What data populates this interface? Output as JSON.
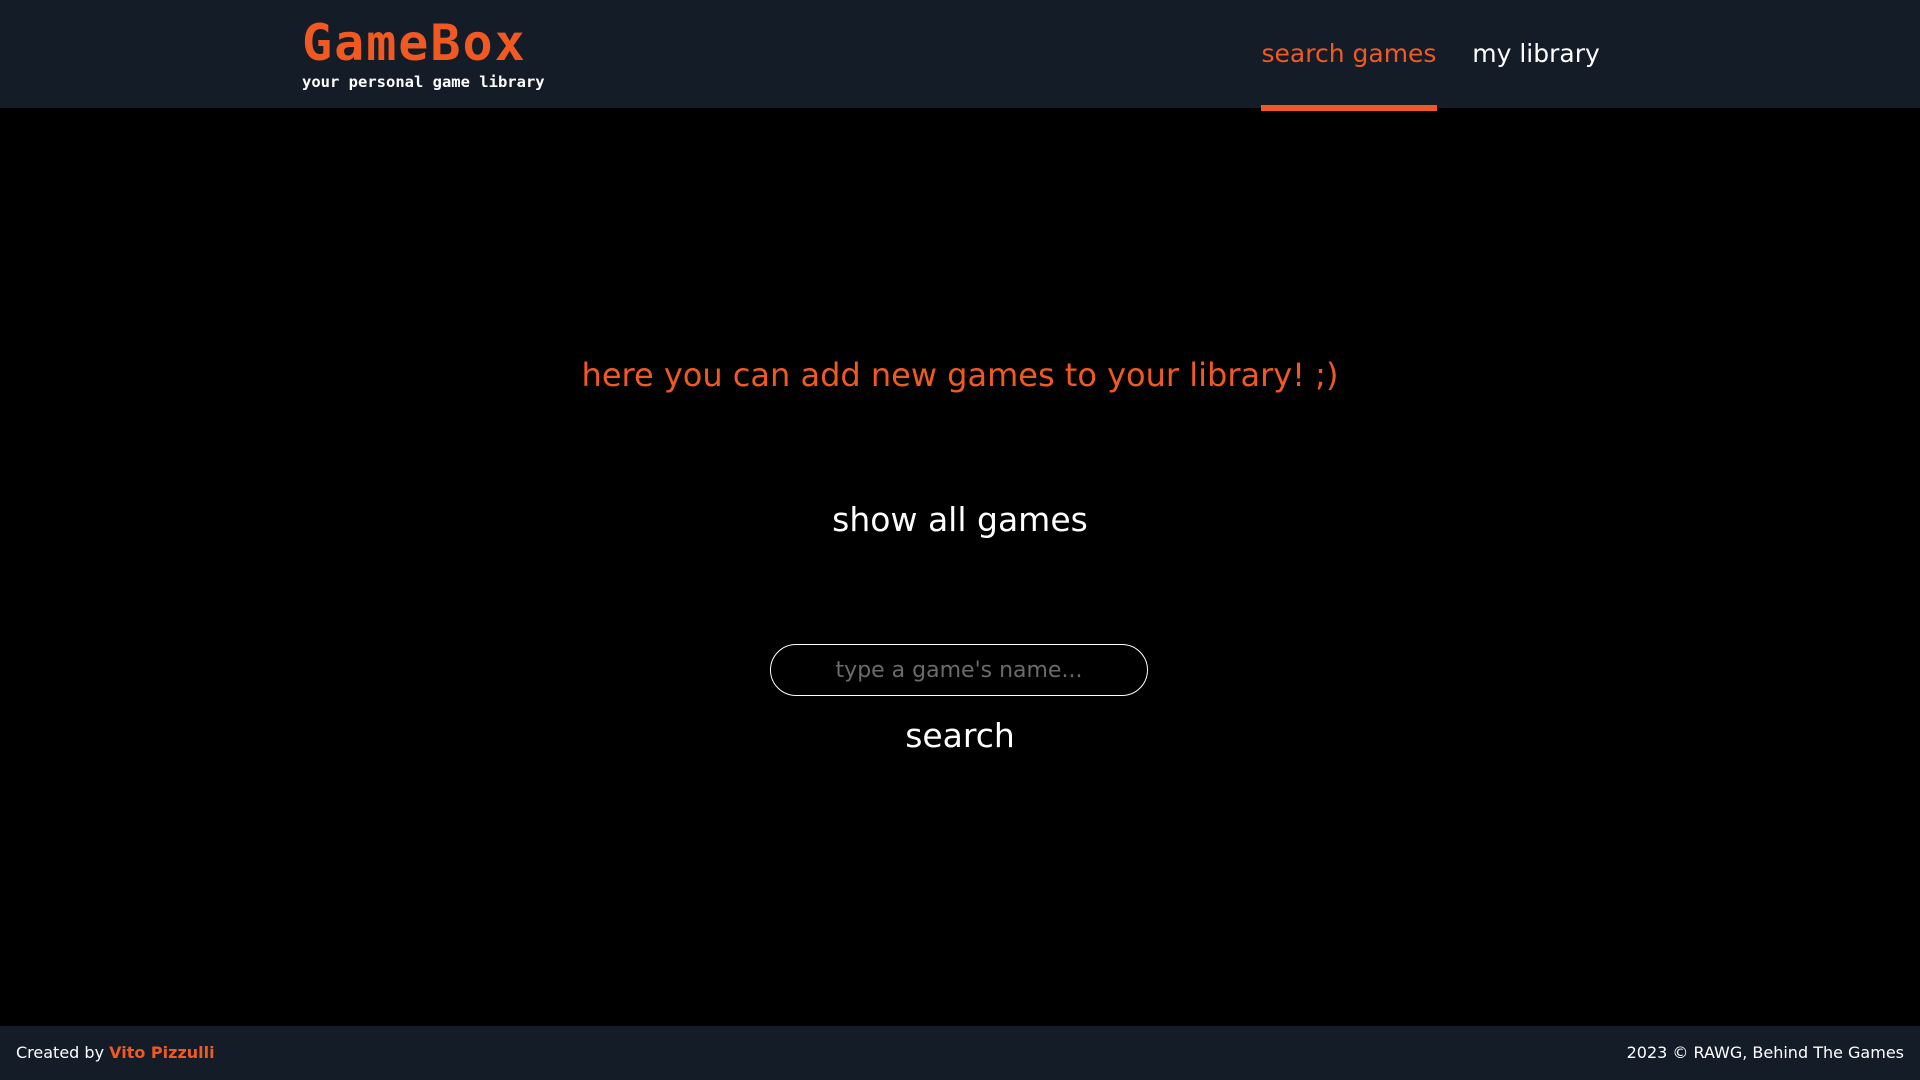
{
  "header": {
    "logo_title": "GameBox",
    "logo_subtitle": "your personal game library",
    "nav": {
      "search_games": "search games",
      "my_library": "my library"
    }
  },
  "main": {
    "tagline": "here you can add new games to your library! ;)",
    "show_all_label": "show all games",
    "search_placeholder": "type a game's name...",
    "search_value": "",
    "search_button_label": "search"
  },
  "footer": {
    "created_by_prefix": "Created by",
    "author": "Vito Pizzulli",
    "copyright": "2023 © RAWG, Behind The Games"
  },
  "colors": {
    "accent": "#f05a22",
    "header_bg": "#141c28",
    "page_bg": "#000000",
    "text": "#ffffff",
    "placeholder": "#6b6b6b"
  }
}
